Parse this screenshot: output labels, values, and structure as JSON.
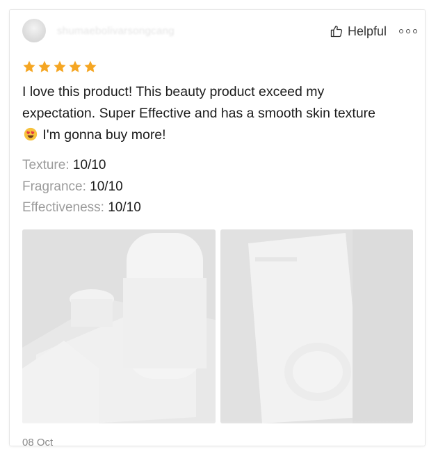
{
  "review": {
    "username": "shumaebolivarsongcang",
    "helpful_label": "Helpful",
    "stars": 5,
    "star_color": "#f5a623",
    "text_part1": "I love this product! This beauty product exceed my expectation. Super Effective and has a smooth skin texture",
    "emoji": "heart-eyes-emoji",
    "text_part2": "I'm gonna buy more!",
    "ratings": [
      {
        "label": "Texture:",
        "value": "10/10"
      },
      {
        "label": "Fragrance:",
        "value": "10/10"
      },
      {
        "label": "Effectiveness:",
        "value": "10/10"
      }
    ],
    "date": "08 Oct"
  },
  "icons": {
    "helpful": "thumbs-up-icon",
    "more": "more-options-icon"
  }
}
